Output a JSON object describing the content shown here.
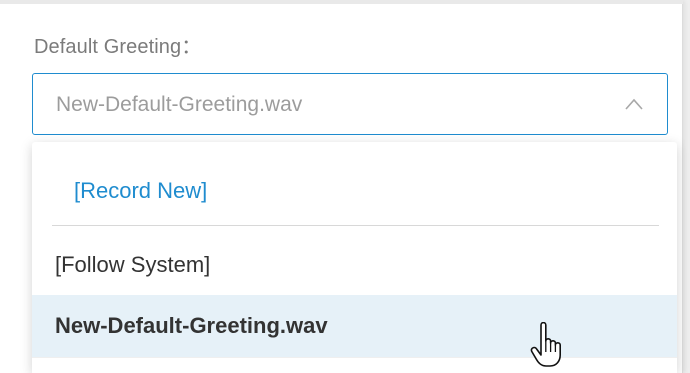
{
  "field": {
    "label": "Default Greeting：",
    "selected_value": "New-Default-Greeting.wav",
    "open_icon": "chevron-up-icon"
  },
  "dropdown": {
    "options": [
      {
        "label": "[Record New]",
        "kind": "action"
      },
      {
        "label": "[Follow System]",
        "kind": "option"
      },
      {
        "label": "New-Default-Greeting.wav",
        "kind": "option",
        "highlighted": true
      }
    ]
  },
  "pointer": {
    "icon": "hand-pointer-icon"
  },
  "colors": {
    "accent": "#1f8ccf",
    "highlight_row": "#e6f1f8",
    "label_text": "#7b7b7b",
    "value_text": "#9c9c9c",
    "option_text": "#333333"
  }
}
